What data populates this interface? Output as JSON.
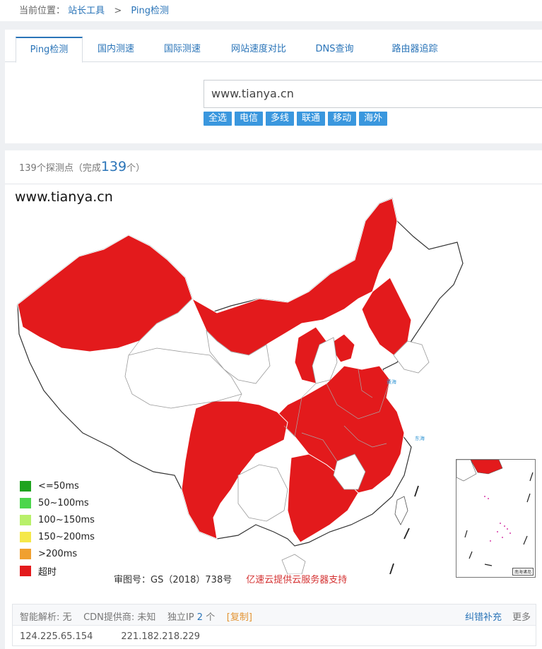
{
  "breadcrumb": {
    "prefix": "当前位置：",
    "items": [
      "站长工具",
      "Ping检测"
    ],
    "separator": ">"
  },
  "tabs": [
    {
      "label": "Ping检测",
      "active": true
    },
    {
      "label": "国内测速",
      "active": false
    },
    {
      "label": "国际测速",
      "active": false
    },
    {
      "label": "网站速度对比",
      "active": false
    },
    {
      "label": "DNS查询",
      "active": false
    },
    {
      "label": "路由器追踪",
      "active": false
    }
  ],
  "search": {
    "value": "www.tianya.cn"
  },
  "filters": [
    "全选",
    "电信",
    "多线",
    "联通",
    "移动",
    "海外"
  ],
  "status": {
    "prefix": "139个探测点（完成",
    "completed": "139",
    "suffix": "个）"
  },
  "map": {
    "title": "www.tianya.cn",
    "colors": {
      "timeout": "#e31a1c",
      "none": "#ffffff",
      "border": "#9a9a9a"
    },
    "inset_label": "南海诸岛"
  },
  "legend": [
    {
      "label": "<=50ms",
      "color": "#1fa31f"
    },
    {
      "label": "50~100ms",
      "color": "#4cd64c"
    },
    {
      "label": "100~150ms",
      "color": "#b8f06a"
    },
    {
      "label": "150~200ms",
      "color": "#f5e84a"
    },
    {
      "label": ">200ms",
      "color": "#f0a030"
    },
    {
      "label": "超时",
      "color": "#e31a1c"
    }
  ],
  "credits": {
    "approval": "审图号：GS（2018）738号",
    "sponsor": "亿速云提供云服务器支持"
  },
  "info": {
    "dns_label": "智能解析:",
    "dns_value": "无",
    "cdn_label": "CDN提供商:",
    "cdn_value": "未知",
    "ip_label": "独立IP",
    "ip_count": "2",
    "ip_unit": "个",
    "copy": "[复制]",
    "feedback": "纠错补充",
    "more": "更多",
    "ips": [
      "124.225.65.154",
      "221.182.218.229"
    ]
  }
}
